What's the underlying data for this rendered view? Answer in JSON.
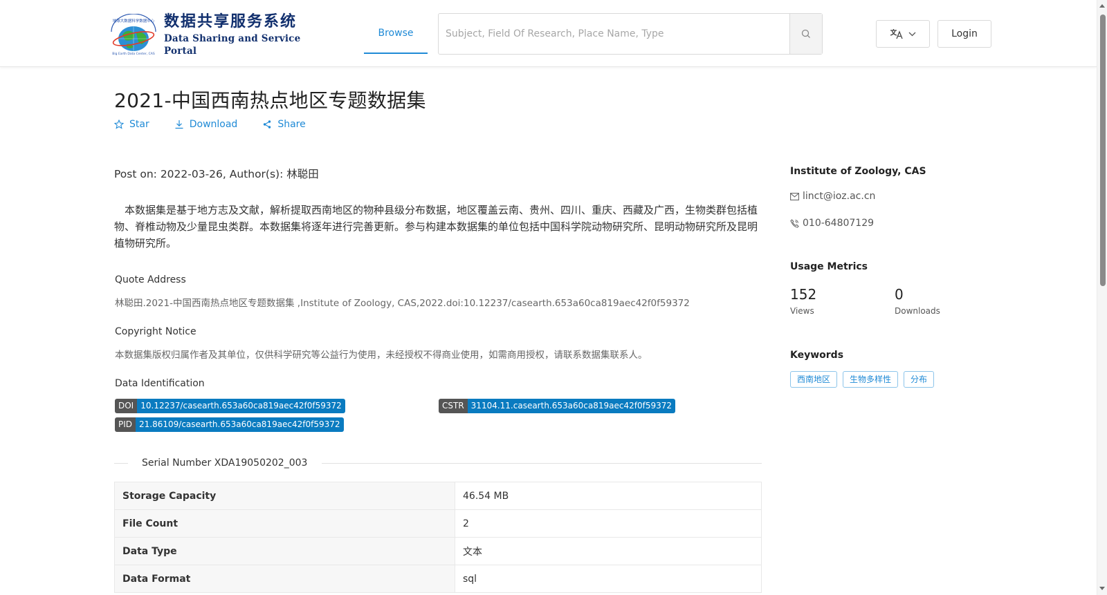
{
  "header": {
    "logo_cn": "数据共享服务系统",
    "logo_en": "Data Sharing and Service Portal",
    "nav_browse": "Browse",
    "search_placeholder": "Subject, Field Of Research, Place Name, Type",
    "login_label": "Login"
  },
  "dataset": {
    "title": "2021-中国西南热点地区专题数据集",
    "actions": {
      "star": "Star",
      "download": "Download",
      "share": "Share"
    },
    "post_on": "Post on: 2022-03-26, Author(s): 林聪田",
    "description": "本数据集是基于地方志及文献，解析提取西南地区的物种县级分布数据，地区覆盖云南、贵州、四川、重庆、西藏及广西，生物类群包括植物、脊椎动物及少量昆虫类群。本数据集将逐年进行完善更新。参与构建本数据集的单位包括中国科学院动物研究所、昆明动物研究所及昆明植物研究所。",
    "quote_label": "Quote Address",
    "quote_text": "林聪田.2021-中国西南热点地区专题数据集 ,Institute of Zoology, CAS,2022.doi:10.12237/casearth.653a60ca819aec42f0f59372",
    "copyright_label": "Copyright Notice",
    "copyright_text": "本数据集版权归属作者及其单位，仅供科学研究等公益行为使用，未经授权不得商业使用，如需商用授权，请联系数据集联系人。",
    "identification_label": "Data Identification",
    "ids": {
      "doi_key": "DOI",
      "doi_val": "10.12237/casearth.653a60ca819aec42f0f59372",
      "cstr_key": "CSTR",
      "cstr_val": "31104.11.casearth.653a60ca819aec42f0f59372",
      "pid_key": "PID",
      "pid_val": "21.86109/casearth.653a60ca819aec42f0f59372"
    },
    "serial_number": "Serial Number XDA19050202_003",
    "table": [
      {
        "key": "Storage Capacity",
        "value": "46.54 MB"
      },
      {
        "key": "File Count",
        "value": "2"
      },
      {
        "key": "Data Type",
        "value": "文本"
      },
      {
        "key": "Data Format",
        "value": "sql"
      }
    ]
  },
  "sidebar": {
    "institute": "Institute of Zoology, CAS",
    "email": "linct@ioz.ac.cn",
    "phone": "010-64807129",
    "usage_heading": "Usage Metrics",
    "views_count": "152",
    "views_label": "Views",
    "downloads_count": "0",
    "downloads_label": "Downloads",
    "keywords_heading": "Keywords",
    "keywords": [
      "西南地区",
      "生物多样性",
      "分布"
    ]
  },
  "colors": {
    "accent": "#1f8ad6",
    "brand_navy": "#12306e",
    "badge_blue": "#0a7bc0",
    "badge_gray": "#555555"
  },
  "icons": {
    "star": "star-icon",
    "download": "download-icon",
    "share": "share-icon",
    "search": "search-icon",
    "language": "translate-icon",
    "email": "mail-icon",
    "phone": "phone-icon"
  }
}
